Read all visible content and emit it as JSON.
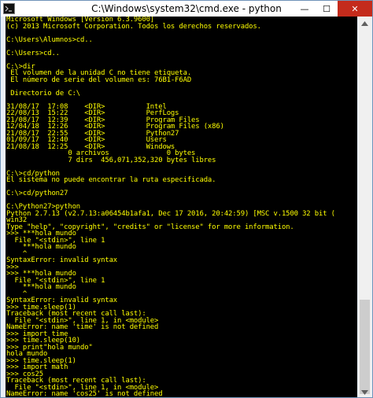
{
  "window": {
    "title": "C:\\Windows\\system32\\cmd.exe - python",
    "controls": {
      "minimize": "—",
      "maximize": "☐",
      "close": "✕"
    }
  },
  "console": {
    "lines": [
      "Microsoft Windows [Versión 6.3.9600]",
      "(c) 2013 Microsoft Corporation. Todos los derechos reservados.",
      "",
      "C:\\Users\\Alumnos>cd..",
      "",
      "C:\\Users>cd..",
      "",
      "C:\\>dir",
      " El volumen de la unidad C no tiene etiqueta.",
      " El número de serie del volumen es: 76B1-F6AD",
      "",
      " Directorio de C:\\",
      "",
      "31/08/17  17:08    <DIR>          Intel",
      "22/08/13  15:22    <DIR>          PerfLogs",
      "21/08/17  12:39    <DIR>          Program Files",
      "12/04/18  12:26    <DIR>          Program Files (x86)",
      "21/08/17  22:55    <DIR>          Python27",
      "01/09/17  12:40    <DIR>          Users",
      "21/08/18  12:25    <DIR>          Windows",
      "               0 archivos              0 bytes",
      "               7 dirs  456,071,352,320 bytes libres",
      "",
      "C:\\>cd/python",
      "El sistema no puede encontrar la ruta especificada.",
      "",
      "C:\\>cd/python27",
      "",
      "C:\\Python27>python",
      "Python 2.7.13 (v2.7.13:a06454b1afa1, Dec 17 2016, 20:42:59) [MSC v.1500 32 bit (",
      "win32",
      "Type \"help\", \"copyright\", \"credits\" or \"license\" for more information.",
      ">>> ***hola mundo",
      "  File \"<stdin>\", line 1",
      "    ***hola mundo",
      "    ^",
      "SyntaxError: invalid syntax",
      ">>>",
      ">>> ***hola mundo",
      "  File \"<stdin>\", line 1",
      "    ***hola mundo",
      "    ^",
      "SyntaxError: invalid syntax",
      ">>> time.sleep(1)",
      "Traceback (most recent call last):",
      "  File \"<stdin>\", line 1, in <module>",
      "NameError: name 'time' is not defined",
      ">>> import time",
      ">>> time.sleep(10)",
      ">>> print\"hola mundo\"",
      "hola mundo",
      ">>> time.sleep(1)",
      ">>> import math",
      ">>> cos25",
      "Traceback (most recent call last):",
      "  File \"<stdin>\", line 1, in <module>",
      "NameError: name 'cos25' is not defined"
    ]
  },
  "colors": {
    "console_background": "#000000",
    "console_text": "#ffff00",
    "close_button": "#c42b1c"
  },
  "icons": {
    "app": "cmd-icon",
    "scroll_up": "arrow-up-icon",
    "scroll_down": "arrow-down-icon"
  }
}
